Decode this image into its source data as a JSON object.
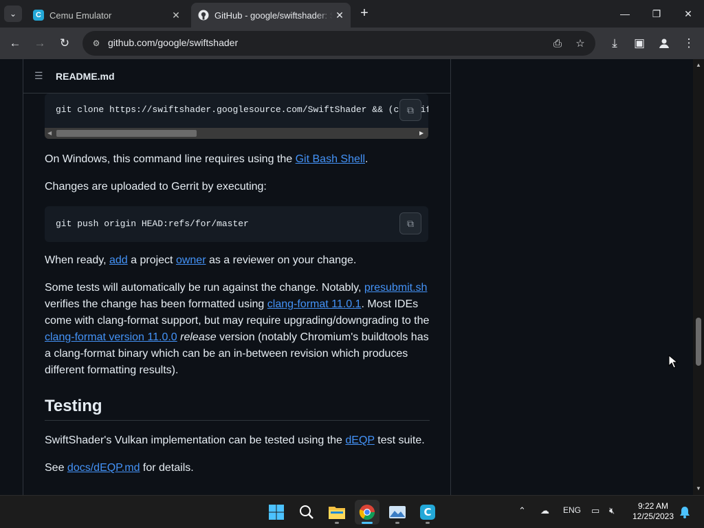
{
  "browser": {
    "tabs": [
      {
        "title": "Cemu Emulator",
        "icon": "cemu-icon",
        "active": false
      },
      {
        "title": "GitHub - google/swiftshader: SwiftShader",
        "icon": "github-icon",
        "active": true
      }
    ],
    "address": "github.com/google/swiftshader"
  },
  "readme": {
    "filename": "README.md",
    "clone_command": "git clone https://swiftshader.googlesource.com/SwiftShader && (cd SwiftSh",
    "windows_note": {
      "before": "On Windows, this command line requires using the ",
      "link": "Git Bash Shell",
      "after": "."
    },
    "gerrit_text": "Changes are uploaded to Gerrit by executing:",
    "push_command": "git push origin HEAD:refs/for/master",
    "ready": {
      "t1": "When ready, ",
      "link1": "add",
      "t2": " a project ",
      "link2": "owner",
      "t3": " as a reviewer on your change."
    },
    "tests": {
      "t1": "Some tests will automatically be run against the change. Notably, ",
      "link1": "presubmit.sh",
      "t2": " verifies the change has been formatted using ",
      "link2": "clang-format 11.0.1",
      "t3": ". Most IDEs come with clang-format support, but may require upgrading/downgrading to the ",
      "link3": "clang-format version 11.0.0",
      "t4": " ",
      "em": "release",
      "t5": " version (notably Chromium's buildtools has a clang-format binary which can be an in-between revision which produces different formatting results)."
    },
    "testing_heading": "Testing",
    "vulkan": {
      "t1": "SwiftShader's Vulkan implementation can be tested using the ",
      "link": "dEQP",
      "t2": " test suite."
    },
    "see": {
      "t1": "See ",
      "link": "docs/dEQP.md",
      "t2": " for details."
    }
  },
  "taskbar": {
    "apps": [
      "windows-start-icon",
      "search-icon",
      "file-explorer-icon",
      "chrome-icon",
      "photos-icon",
      "cemu-icon"
    ],
    "language": "ENG",
    "time": "9:22 AM",
    "date": "12/25/2023"
  }
}
